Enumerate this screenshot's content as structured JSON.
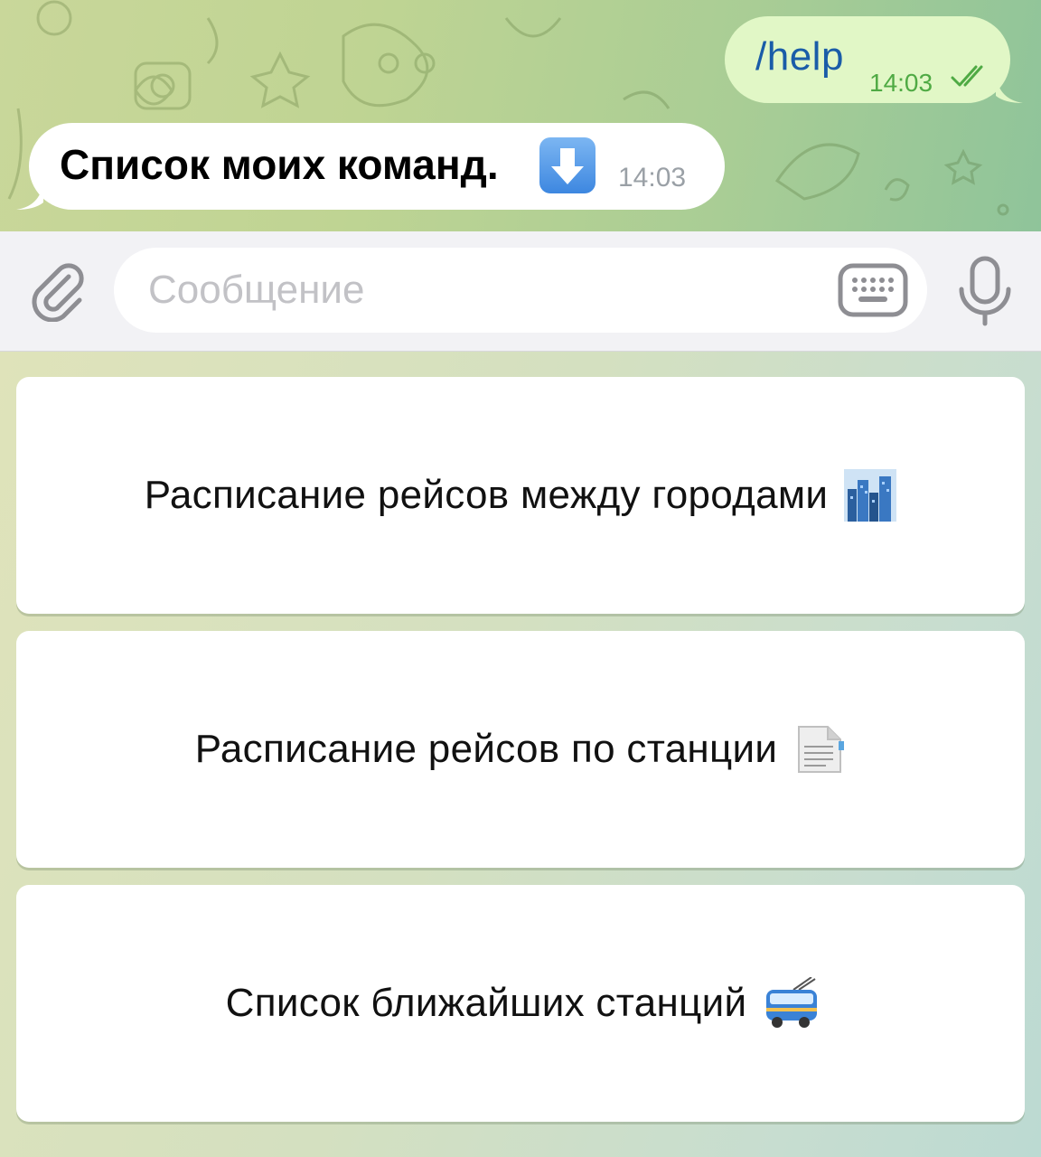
{
  "chat": {
    "outgoing": {
      "text": "/help",
      "time": "14:03",
      "status_icon": "double-check-icon"
    },
    "incoming": {
      "text": "Список моих команд.",
      "emoji": "down-arrow-emoji-icon",
      "time": "14:03"
    }
  },
  "composer": {
    "placeholder": "Сообщение",
    "attach_icon": "paperclip-icon",
    "keyboard_icon": "keyboard-icon",
    "mic_icon": "microphone-icon"
  },
  "keyboard": {
    "buttons": [
      {
        "label": "Расписание рейсов между городами",
        "emoji": "cityscape-emoji-icon"
      },
      {
        "label": "Расписание рейсов по станции",
        "emoji": "page-emoji-icon"
      },
      {
        "label": "Список ближайших станций",
        "emoji": "trolleybus-emoji-icon"
      }
    ]
  },
  "colors": {
    "outgoing_bubble": "#e1f7c6",
    "outgoing_text": "#1a5ca8",
    "outgoing_time": "#4faa44",
    "incoming_bubble": "#ffffff",
    "icon_gray": "#8e8e93"
  }
}
